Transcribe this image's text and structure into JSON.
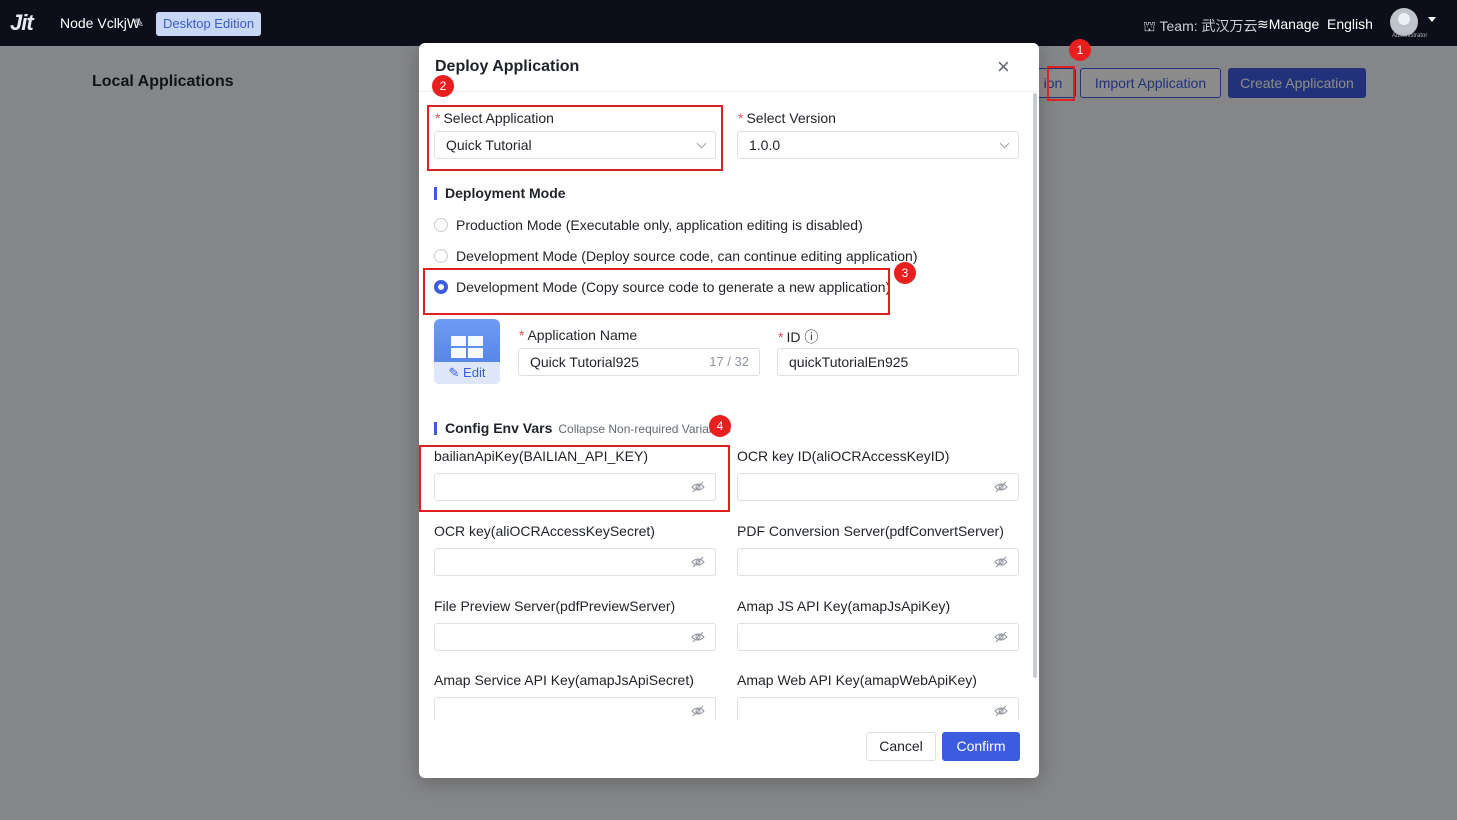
{
  "topbar": {
    "logo": "Jit",
    "node_name": "Node VclkjW",
    "edition": "Desktop Edition",
    "team": "⛫ Team: 武汉万云",
    "manage": "≋Manage",
    "language": "English",
    "avatar_label": "Administrator"
  },
  "page": {
    "title": "Local Applications",
    "partial_button": "ion",
    "import_button": "Import Application",
    "create_button": "Create Application"
  },
  "modal": {
    "title": "Deploy Application",
    "close": "×",
    "select_application": {
      "label": "Select Application",
      "value": "Quick Tutorial"
    },
    "select_version": {
      "label": "Select Version",
      "value": "1.0.0"
    },
    "deployment_section": "Deployment Mode",
    "modes": [
      {
        "label": "Production Mode (Executable only, application editing is disabled)",
        "checked": false
      },
      {
        "label": "Development Mode (Deploy source code, can continue editing application)",
        "checked": false
      },
      {
        "label": "Development Mode (Copy source code to generate a new application)",
        "checked": true
      }
    ],
    "icon_edit": "✎ Edit",
    "app_name": {
      "label": "Application Name",
      "value": "Quick Tutorial925",
      "counter": "17 / 32"
    },
    "app_id": {
      "label": "ID ⓘ",
      "value": "quickTutorialEn925"
    },
    "env_section": "Config Env Vars",
    "env_collapse": "Collapse Non-required Variables",
    "env_vars": [
      {
        "label": "bailianApiKey(BAILIAN_API_KEY)",
        "value": ""
      },
      {
        "label": "OCR key ID(aliOCRAccessKeyID)",
        "value": ""
      },
      {
        "label": "OCR key(aliOCRAccessKeySecret)",
        "value": ""
      },
      {
        "label": "PDF Conversion Server(pdfConvertServer)",
        "value": ""
      },
      {
        "label": "File Preview Server(pdfPreviewServer)",
        "value": ""
      },
      {
        "label": "Amap JS API Key(amapJsApiKey)",
        "value": ""
      },
      {
        "label": "Amap Service API Key(amapJsApiSecret)",
        "value": ""
      },
      {
        "label": "Amap Web API Key(amapWebApiKey)",
        "value": ""
      }
    ],
    "cancel": "Cancel",
    "confirm": "Confirm"
  },
  "annotations": [
    "1",
    "2",
    "3",
    "4"
  ],
  "colors": {
    "primary": "#3c5ce0",
    "annotation": "#e02020",
    "topbar": "#0c0f1a"
  }
}
